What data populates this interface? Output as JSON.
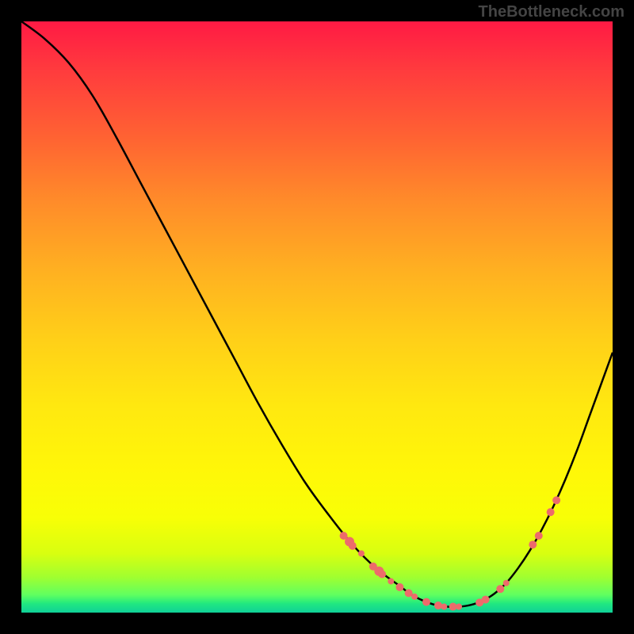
{
  "watermark": "TheBottleneck.com",
  "chart_data": {
    "type": "line",
    "title": "",
    "xlabel": "",
    "ylabel": "",
    "xlim": [
      0,
      100
    ],
    "ylim": [
      0,
      100
    ],
    "curve": [
      {
        "x": 0.0,
        "y": 100.0
      },
      {
        "x": 4.0,
        "y": 97.0
      },
      {
        "x": 8.0,
        "y": 93.0
      },
      {
        "x": 12.0,
        "y": 87.5
      },
      {
        "x": 16.0,
        "y": 80.5
      },
      {
        "x": 20.0,
        "y": 73.0
      },
      {
        "x": 24.0,
        "y": 65.5
      },
      {
        "x": 28.0,
        "y": 58.0
      },
      {
        "x": 32.0,
        "y": 50.5
      },
      {
        "x": 36.0,
        "y": 43.0
      },
      {
        "x": 40.0,
        "y": 35.5
      },
      {
        "x": 44.0,
        "y": 28.5
      },
      {
        "x": 48.0,
        "y": 22.0
      },
      {
        "x": 52.0,
        "y": 16.5
      },
      {
        "x": 56.0,
        "y": 11.5
      },
      {
        "x": 60.0,
        "y": 7.5
      },
      {
        "x": 64.0,
        "y": 4.5
      },
      {
        "x": 66.0,
        "y": 3.0
      },
      {
        "x": 68.0,
        "y": 2.0
      },
      {
        "x": 70.0,
        "y": 1.3
      },
      {
        "x": 72.0,
        "y": 1.0
      },
      {
        "x": 74.0,
        "y": 1.0
      },
      {
        "x": 76.0,
        "y": 1.3
      },
      {
        "x": 78.0,
        "y": 2.0
      },
      {
        "x": 80.0,
        "y": 3.2
      },
      {
        "x": 82.0,
        "y": 5.0
      },
      {
        "x": 84.0,
        "y": 7.5
      },
      {
        "x": 86.0,
        "y": 10.5
      },
      {
        "x": 88.0,
        "y": 14.0
      },
      {
        "x": 90.0,
        "y": 18.0
      },
      {
        "x": 92.0,
        "y": 22.5
      },
      {
        "x": 94.0,
        "y": 27.5
      },
      {
        "x": 96.0,
        "y": 33.0
      },
      {
        "x": 98.0,
        "y": 38.5
      },
      {
        "x": 100.0,
        "y": 44.0
      }
    ],
    "markers": [
      {
        "x": 54.5,
        "y": 13.0,
        "r": 5
      },
      {
        "x": 55.5,
        "y": 12.0,
        "r": 6
      },
      {
        "x": 56.0,
        "y": 11.3,
        "r": 5
      },
      {
        "x": 57.5,
        "y": 10.0,
        "r": 4
      },
      {
        "x": 59.5,
        "y": 7.8,
        "r": 5
      },
      {
        "x": 60.5,
        "y": 7.0,
        "r": 6
      },
      {
        "x": 61.0,
        "y": 6.5,
        "r": 5
      },
      {
        "x": 62.5,
        "y": 5.3,
        "r": 4
      },
      {
        "x": 64.0,
        "y": 4.3,
        "r": 5
      },
      {
        "x": 65.5,
        "y": 3.3,
        "r": 5
      },
      {
        "x": 66.5,
        "y": 2.7,
        "r": 4
      },
      {
        "x": 68.5,
        "y": 1.8,
        "r": 5
      },
      {
        "x": 70.5,
        "y": 1.2,
        "r": 5
      },
      {
        "x": 71.5,
        "y": 1.0,
        "r": 4
      },
      {
        "x": 73.0,
        "y": 1.0,
        "r": 5
      },
      {
        "x": 74.0,
        "y": 1.0,
        "r": 4
      },
      {
        "x": 77.5,
        "y": 1.7,
        "r": 5
      },
      {
        "x": 78.5,
        "y": 2.2,
        "r": 5
      },
      {
        "x": 81.0,
        "y": 4.0,
        "r": 5
      },
      {
        "x": 82.0,
        "y": 5.0,
        "r": 4
      },
      {
        "x": 86.5,
        "y": 11.5,
        "r": 5
      },
      {
        "x": 87.5,
        "y": 13.0,
        "r": 5
      },
      {
        "x": 89.5,
        "y": 17.0,
        "r": 5
      },
      {
        "x": 90.5,
        "y": 19.0,
        "r": 5
      }
    ],
    "marker_color": "#ed6b6b",
    "curve_color": "#000000"
  }
}
